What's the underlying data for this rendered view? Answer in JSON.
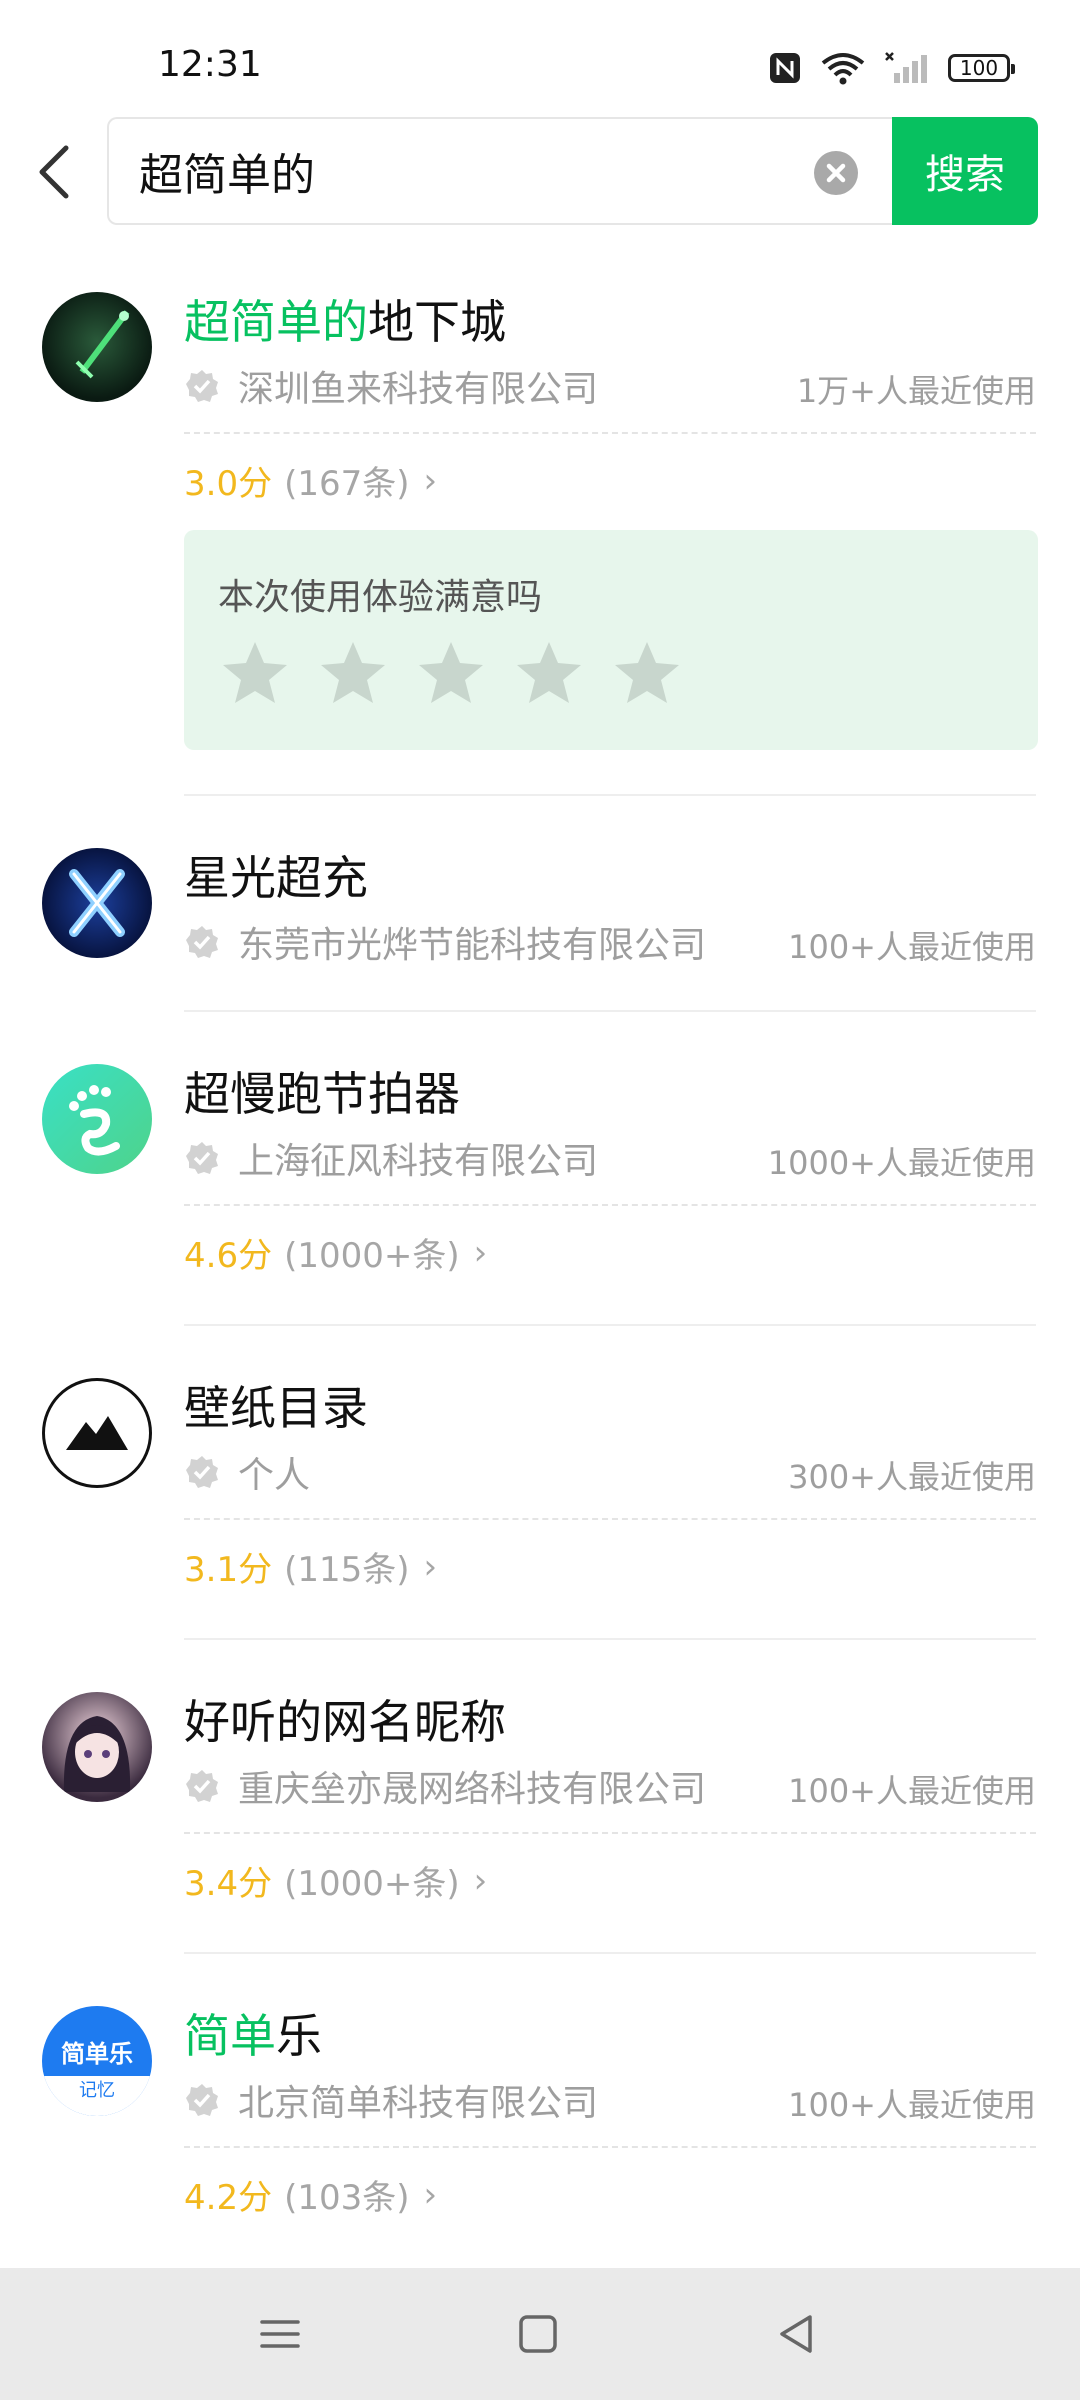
{
  "status_bar": {
    "time": "12:31",
    "battery": "100"
  },
  "search": {
    "query": "超简单的",
    "button_label": "搜索"
  },
  "feedback": {
    "prompt": "本次使用体验满意吗",
    "stars": 5
  },
  "results": [
    {
      "title_hl": "超简单的",
      "title_rest": "地下城",
      "company": "深圳鱼来科技有限公司",
      "usage": "1万+人最近使用",
      "score": "3.0分",
      "reviews": "(167条)"
    },
    {
      "title_hl": "",
      "title_rest": "星光超充",
      "company": "东莞市光烨节能科技有限公司",
      "usage": "100+人最近使用"
    },
    {
      "title_hl": "",
      "title_rest": "超慢跑节拍器",
      "company": "上海征风科技有限公司",
      "usage": "1000+人最近使用",
      "score": "4.6分",
      "reviews": "(1000+条)"
    },
    {
      "title_hl": "",
      "title_rest": "壁纸目录",
      "company": "个人",
      "usage": "300+人最近使用",
      "score": "3.1分",
      "reviews": "(115条)"
    },
    {
      "title_hl": "",
      "title_rest": "好听的网名昵称",
      "company": "重庆垒亦晟网络科技有限公司",
      "usage": "100+人最近使用",
      "score": "3.4分",
      "reviews": "(1000+条)"
    },
    {
      "title_hl": "简单",
      "title_rest": "乐",
      "company": "北京简单科技有限公司",
      "usage": "100+人最近使用",
      "score": "4.2分",
      "reviews": "(103条)",
      "icon_text": "简单乐",
      "icon_subtext": "记忆"
    }
  ],
  "colors": {
    "accent": "#07c160",
    "score": "#f2b81e",
    "muted": "#9e9e9e"
  },
  "icons": [
    "back-arrow-icon",
    "clear-icon",
    "verified-icon",
    "chevron-right-icon",
    "star-icon",
    "menu-icon",
    "home-icon",
    "back-icon"
  ]
}
